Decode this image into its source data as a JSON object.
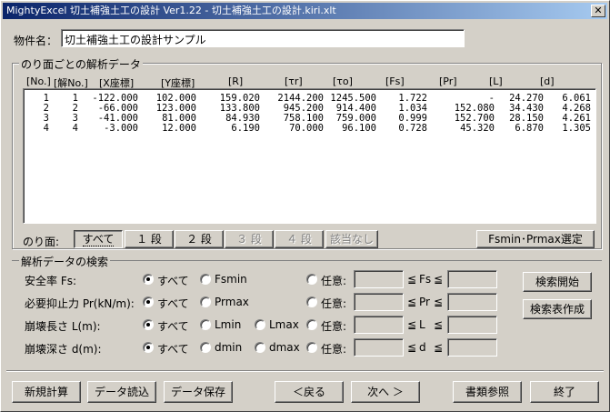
{
  "window": {
    "title": "MightyExcel 切土補強土工の設計 Ver1.22 - 切土補強土工の設計.kiri.xlt",
    "close": "✕"
  },
  "property": {
    "label": "物件名：",
    "value": "切土補強土工の設計サンプル"
  },
  "analysis_group": {
    "title": "のり面ごとの解析データ"
  },
  "table": {
    "headers": [
      "[No.]",
      "[解No.]",
      "[X座標]",
      "[Y座標]",
      "[R]",
      "[τr]",
      "[τo]",
      "[Fs]",
      "[Pr]",
      "[L]",
      "[d]"
    ],
    "rows": [
      [
        "1",
        "1",
        "-122.000",
        "102.000",
        "159.020",
        "2144.200",
        "1245.500",
        "1.722",
        "-",
        "24.270",
        "6.061"
      ],
      [
        "2",
        "2",
        "-66.000",
        "123.000",
        "133.800",
        "945.200",
        "914.400",
        "1.034",
        "152.080",
        "34.430",
        "4.268"
      ],
      [
        "3",
        "3",
        "-41.000",
        "81.000",
        "84.930",
        "758.100",
        "759.000",
        "0.999",
        "152.700",
        "28.150",
        "4.261"
      ],
      [
        "4",
        "4",
        "-3.000",
        "12.000",
        "6.190",
        "70.000",
        "96.100",
        "0.728",
        "45.320",
        "6.870",
        "1.305"
      ]
    ]
  },
  "slope_tabs": {
    "label": "のり面:",
    "tabs": [
      "すべて",
      "１ 段",
      "２ 段",
      "３ 段",
      "４ 段",
      "該当なし"
    ],
    "fsmin_button": "Fsmin･Prmax選定"
  },
  "search": {
    "title": "解析データの検索",
    "rows": [
      {
        "label": "安全率 Fs:",
        "all": "すべて",
        "opt1": "Fsmin",
        "opt2": "",
        "any": "任意:",
        "le1": "≦",
        "var": "Fs",
        "le2": "≦"
      },
      {
        "label": "必要抑止力 Pr(kN/m):",
        "all": "すべて",
        "opt1": "Prmax",
        "opt2": "",
        "any": "任意:",
        "le1": "≦",
        "var": "Pr",
        "le2": "≦"
      },
      {
        "label": "崩壊長さ L(m):",
        "all": "すべて",
        "opt1": "Lmin",
        "opt2": "Lmax",
        "any": "任意:",
        "le1": "≦",
        "var": "L",
        "le2": "≦"
      },
      {
        "label": "崩壊深さ d(m):",
        "all": "すべて",
        "opt1": "dmin",
        "opt2": "dmax",
        "any": "任意:",
        "le1": "≦",
        "var": "d",
        "le2": "≦"
      }
    ],
    "start_button": "検索開始",
    "create_button": "検索表作成"
  },
  "footer": {
    "new_calc": "新規計算",
    "load": "データ読込",
    "save": "データ保存",
    "back": "＜戻る",
    "next": "次へ ＞",
    "ref": "書類参照",
    "exit": "終了"
  }
}
